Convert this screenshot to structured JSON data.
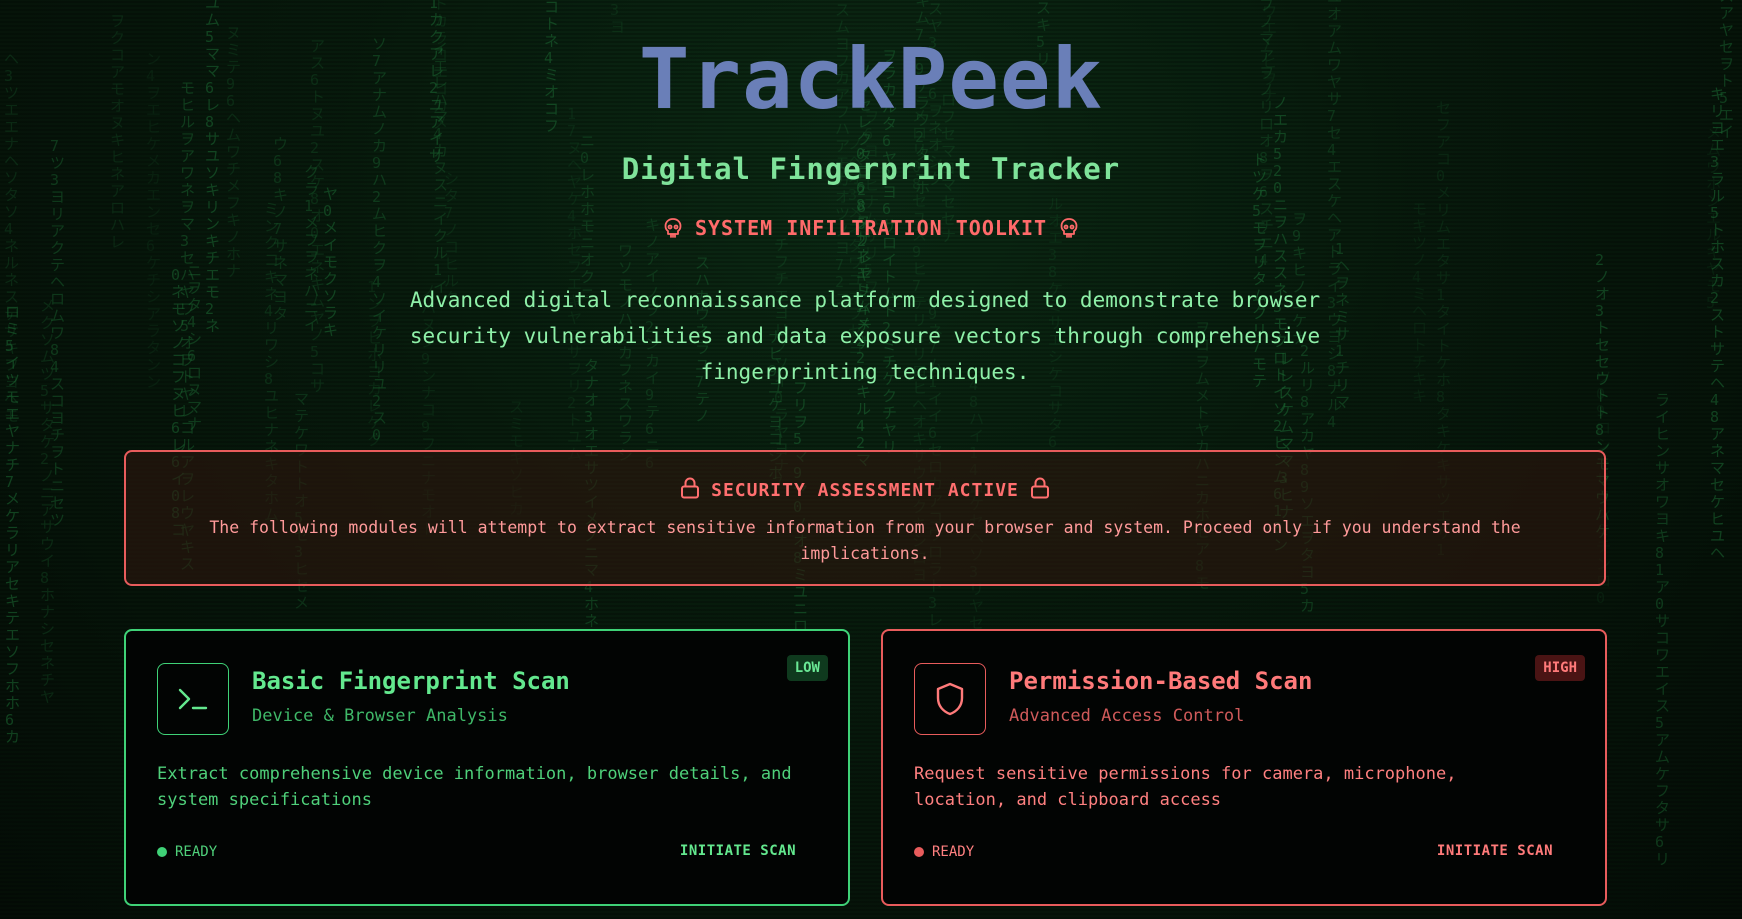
{
  "header": {
    "title": "TrackPeek",
    "subtitle": "Digital Fingerprint Tracker",
    "toolkit_label": "SYSTEM INFILTRATION TOOLKIT",
    "description": "Advanced digital reconnaissance platform designed to demonstrate browser security vulnerabilities and data exposure vectors through comprehensive fingerprinting techniques."
  },
  "alert": {
    "title": "SECURITY ASSESSMENT ACTIVE",
    "text": "The following modules will attempt to extract sensitive information from your browser and system. Proceed only if you understand the implications."
  },
  "cards": [
    {
      "title": "Basic Fingerprint Scan",
      "subtitle": "Device & Browser Analysis",
      "badge": "LOW",
      "description": "Extract comprehensive device information, browser details, and system specifications",
      "status": "READY",
      "action": "INITIATE SCAN",
      "icon": "terminal-icon",
      "accent": "#3fd277"
    },
    {
      "title": "Permission-Based Scan",
      "subtitle": "Advanced Access Control",
      "badge": "HIGH",
      "description": "Request sensitive permissions for camera, microphone, location, and clipboard access",
      "status": "READY",
      "action": "INITIATE SCAN",
      "icon": "shield-icon",
      "accent": "#e85c5c"
    }
  ],
  "colors": {
    "background": "#061208",
    "title": "#6a7fb8",
    "green_accent": "#3fd277",
    "red_accent": "#e85c5c"
  }
}
